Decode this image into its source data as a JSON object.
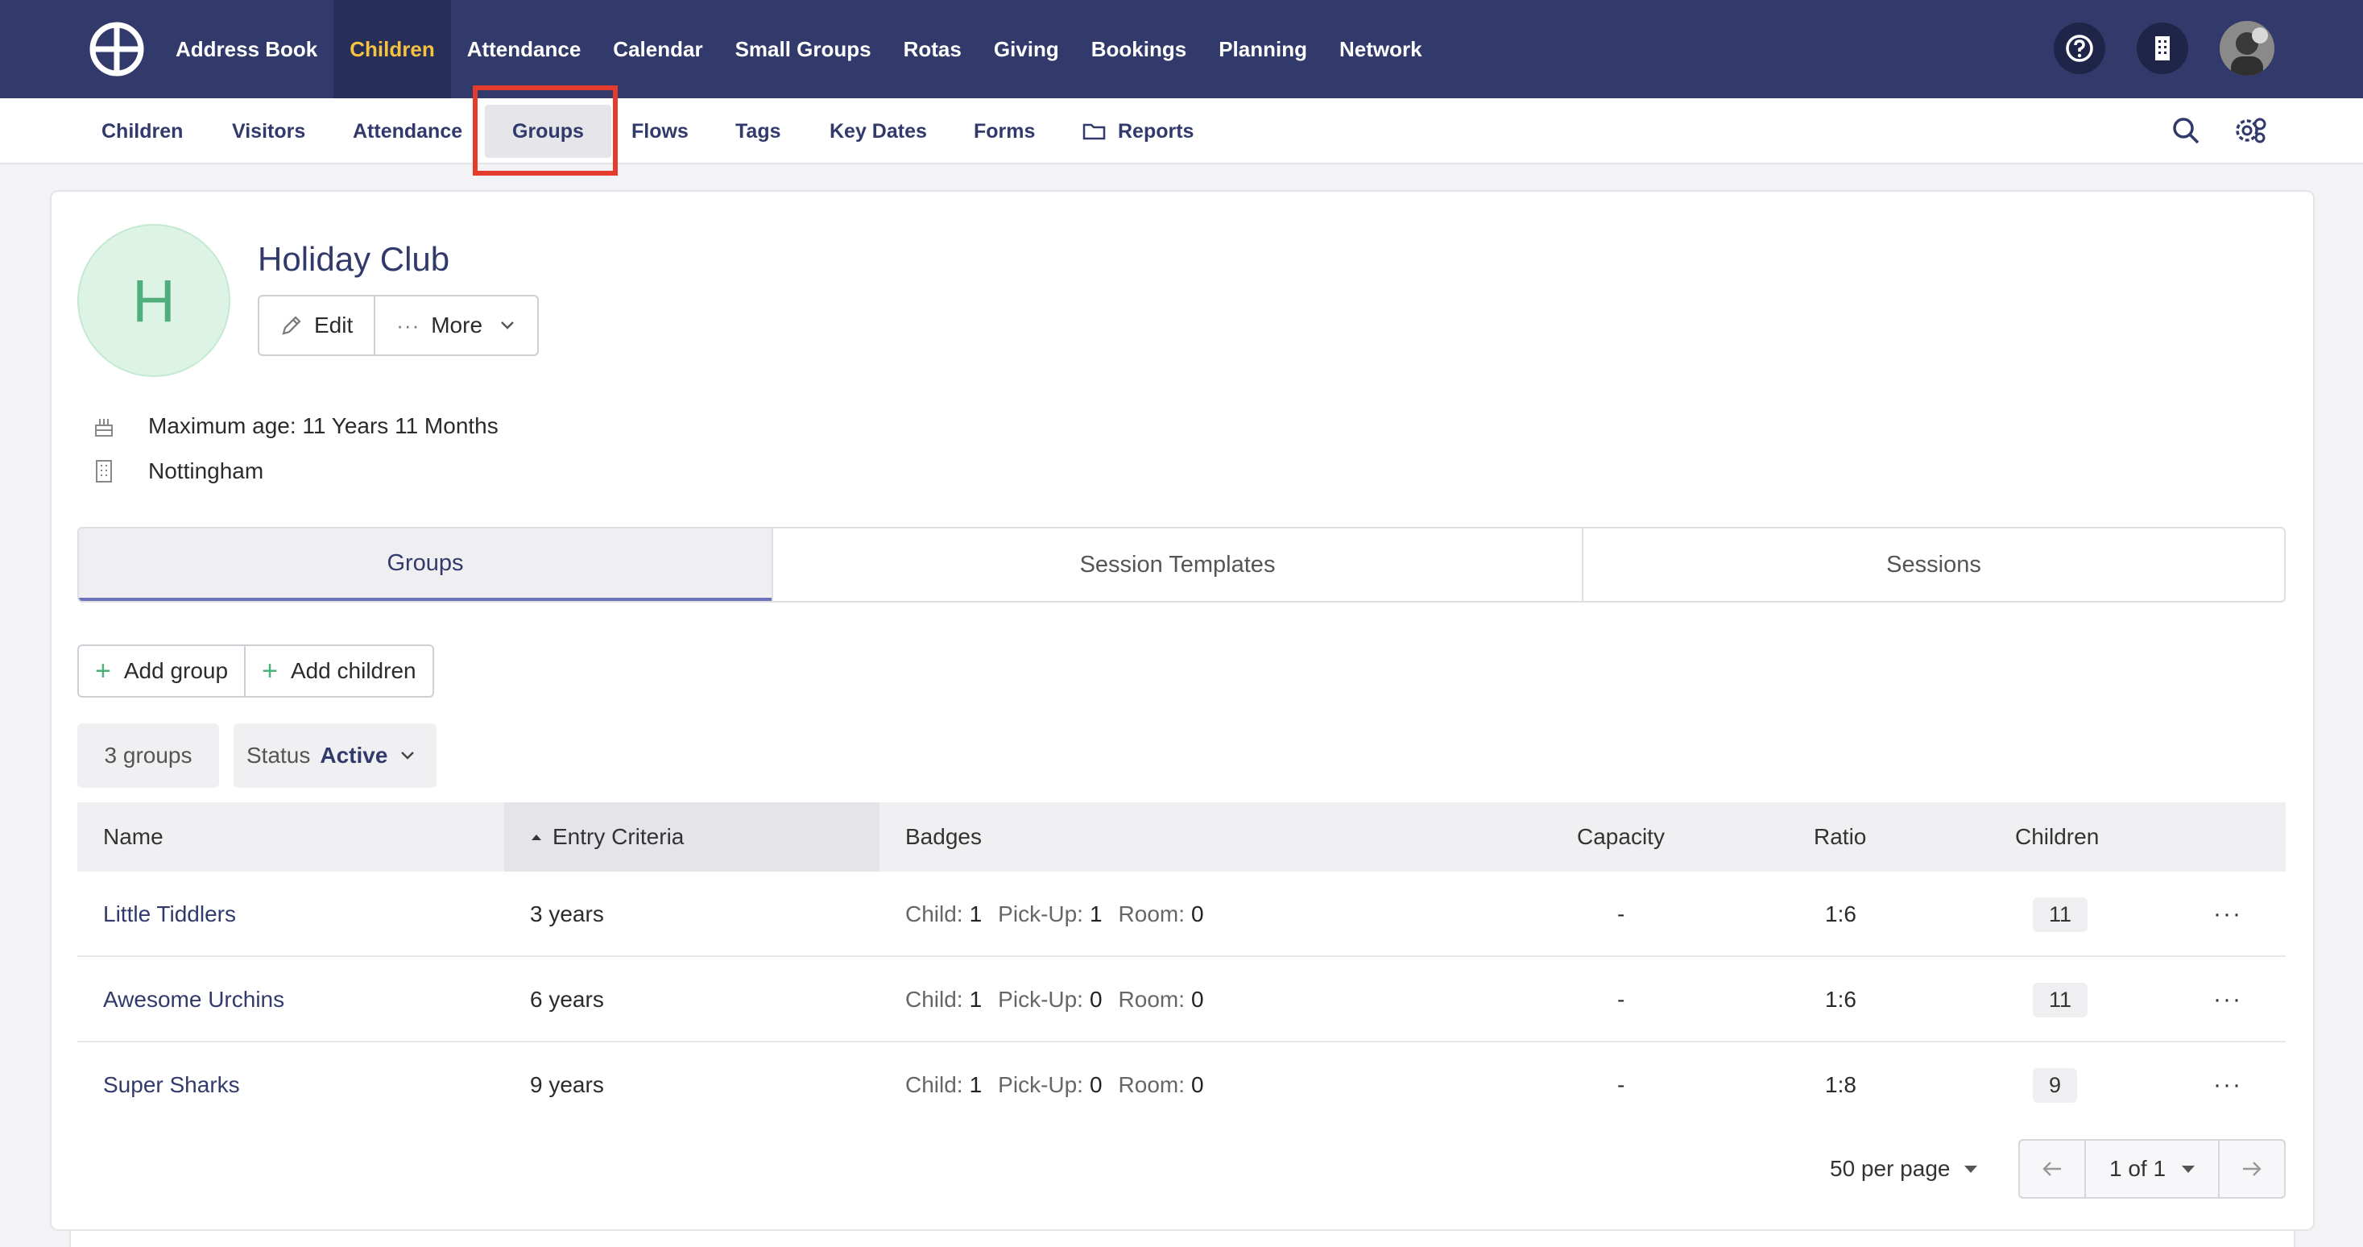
{
  "top_nav": {
    "items": [
      {
        "label": "Address Book"
      },
      {
        "label": "Children",
        "active": true
      },
      {
        "label": "Attendance"
      },
      {
        "label": "Calendar"
      },
      {
        "label": "Small Groups"
      },
      {
        "label": "Rotas"
      },
      {
        "label": "Giving"
      },
      {
        "label": "Bookings"
      },
      {
        "label": "Planning"
      },
      {
        "label": "Network"
      }
    ],
    "active_color": "#f5c242",
    "bg_color": "#323a6b"
  },
  "sub_nav": {
    "items": [
      {
        "label": "Children"
      },
      {
        "label": "Visitors"
      },
      {
        "label": "Attendance"
      },
      {
        "label": "Groups",
        "selected": true
      },
      {
        "label": "Flows"
      },
      {
        "label": "Tags"
      },
      {
        "label": "Key Dates"
      },
      {
        "label": "Forms"
      },
      {
        "label": "Reports"
      }
    ]
  },
  "entity": {
    "initial": "H",
    "title": "Holiday Club",
    "edit_label": "Edit",
    "more_label": "More",
    "max_age": "Maximum age: 11 Years 11 Months",
    "location": "Nottingham"
  },
  "tabs": [
    "Groups",
    "Session Templates",
    "Sessions"
  ],
  "actions": {
    "add_group": "Add group",
    "add_children": "Add children"
  },
  "filters": {
    "count": "3 groups",
    "status_label": "Status",
    "status_value": "Active"
  },
  "table": {
    "headers": [
      "Name",
      "Entry Criteria",
      "Badges",
      "Capacity",
      "Ratio",
      "Children"
    ],
    "badge_labels": {
      "child": "Child:",
      "pickup": "Pick-Up:",
      "room": "Room:"
    },
    "rows": [
      {
        "name": "Little Tiddlers",
        "entry": "3 years",
        "child": "1",
        "pickup": "1",
        "room": "0",
        "capacity": "-",
        "ratio": "1:6",
        "children": "11"
      },
      {
        "name": "Awesome Urchins",
        "entry": "6 years",
        "child": "1",
        "pickup": "0",
        "room": "0",
        "capacity": "-",
        "ratio": "1:6",
        "children": "11"
      },
      {
        "name": "Super Sharks",
        "entry": "9 years",
        "child": "1",
        "pickup": "0",
        "room": "0",
        "capacity": "-",
        "ratio": "1:8",
        "children": "9"
      }
    ]
  },
  "pagination": {
    "per_page": "50 per page",
    "page": "1 of 1"
  }
}
